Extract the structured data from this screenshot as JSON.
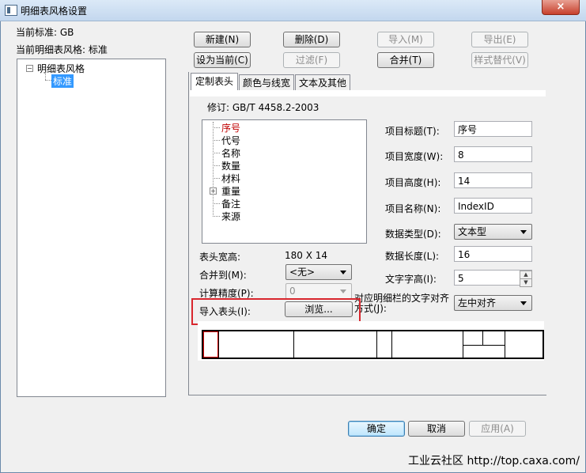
{
  "window": {
    "title": "明细表风格设置",
    "close_icon": "×"
  },
  "left": {
    "current_standard": "当前标准: GB",
    "current_style": "当前明细表风格: 标准",
    "tree": [
      {
        "label": "明细表风格",
        "expanded": true
      },
      {
        "label": "标准",
        "selected": true
      }
    ]
  },
  "toolbar": {
    "new": "新建(N)",
    "delete": "删除(D)",
    "import": "导入(M)",
    "export": "导出(E)",
    "set_current": "设为当前(C)",
    "filter": "过滤(F)",
    "merge": "合并(T)",
    "replace_style": "样式替代(V)"
  },
  "tabs": [
    "定制表头",
    "颜色与线宽",
    "文本及其他"
  ],
  "revision": "修订: GB/T 4458.2-2003",
  "fields": [
    "序号",
    "代号",
    "名称",
    "数量",
    "材料",
    "重量",
    "备注",
    "来源"
  ],
  "props": {
    "title_label": "项目标题(T):",
    "title_value": "序号",
    "width_label": "项目宽度(W):",
    "width_value": "8",
    "height_label": "项目高度(H):",
    "height_value": "14",
    "name_label": "项目名称(N):",
    "name_value": "IndexID",
    "dtype_label": "数据类型(D):",
    "dtype_value": "文本型",
    "dlen_label": "数据长度(L):",
    "dlen_value": "16",
    "textheight_label": "文字字高(I):",
    "textheight_value": "5",
    "align_label": "对应明细栏的文字对齐方式(J):",
    "align_value": "左中对齐"
  },
  "header": {
    "size_label": "表头宽高:",
    "size_value": "180 X 14",
    "merge_label": "合并到(M):",
    "merge_value": "<无>",
    "precision_label": "计算精度(P):",
    "precision_value": "0",
    "import_label": "导入表头(I):",
    "browse": "浏览..."
  },
  "footer": {
    "ok": "确定",
    "cancel": "取消",
    "apply": "应用(A)"
  },
  "watermark": "工业云社区 http://top.caxa.com/"
}
